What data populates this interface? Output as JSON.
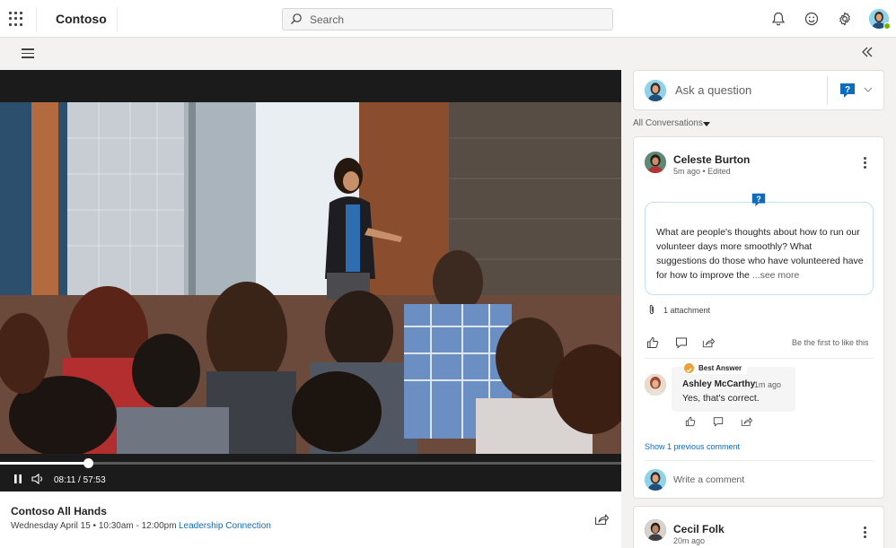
{
  "app": {
    "brand": "Contoso",
    "search_placeholder": "Search",
    "icons": [
      "waffle-icon",
      "search-icon",
      "bell-icon",
      "smiley-icon",
      "gear-icon",
      "avatar"
    ]
  },
  "video": {
    "elapsed": "08:11",
    "duration": "57:53",
    "time_display": "08:11 / 57:53",
    "progress_fraction": 0.1413,
    "state": "playing"
  },
  "event": {
    "title": "Contoso All Hands",
    "meta": "Wednesday April 15 • 10:30am - 12:00pm",
    "link": "Leadership Connection"
  },
  "panel": {
    "ask_placeholder": "Ask a question",
    "filter_label": "All Conversations",
    "accent": "#0f6cbd"
  },
  "post": {
    "author": "Celeste Burton",
    "time": "5m ago • Edited",
    "question": "What are people's thoughts about how to run our volunteer days more smoothly? What suggestions do those who have volunteered have for how to improve the ",
    "see_more": "...see more",
    "attachment": "1 attachment",
    "like_hint": "Be the first to like this",
    "reply": {
      "badge": "Best Answer",
      "author": "Ashley McCarthy",
      "time": "1m ago",
      "text": "Yes, that's correct."
    },
    "show_previous": "Show 1 previous comment",
    "write_placeholder": "Write a comment"
  },
  "post2": {
    "author": "Cecil Folk",
    "time": "20m ago"
  }
}
